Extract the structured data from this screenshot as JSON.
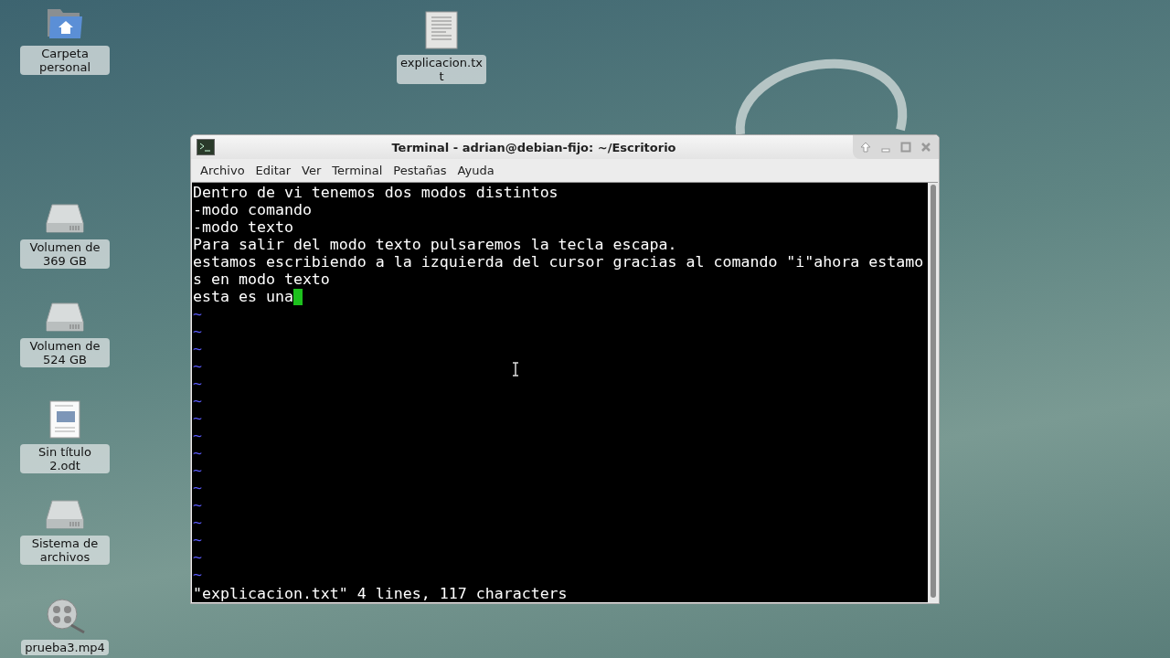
{
  "desktop": {
    "column_icons": [
      {
        "kind": "home-folder",
        "label": "Carpeta personal"
      },
      {
        "kind": "drive",
        "label": "Volumen de 369 GB"
      },
      {
        "kind": "drive",
        "label": "Volumen de 524 GB"
      },
      {
        "kind": "document",
        "label": "Sin título 2.odt"
      },
      {
        "kind": "drive",
        "label": "Sistema de archivos"
      },
      {
        "kind": "video",
        "label": "prueba3.mp4"
      }
    ],
    "top_icons": [
      {
        "kind": "text-file",
        "label": "explicacion.txt"
      }
    ]
  },
  "window": {
    "title": "Terminal - adrian@debian-fijo: ~/Escritorio",
    "menu": [
      "Archivo",
      "Editar",
      "Ver",
      "Terminal",
      "Pestañas",
      "Ayuda"
    ],
    "buffer_lines": [
      {
        "text": "Dentro de vi tenemos dos modos distintos",
        "cursor": false
      },
      {
        "text": "-modo comando",
        "cursor": false
      },
      {
        "text": "-modo texto",
        "cursor": false
      },
      {
        "text": "Para salir del modo texto pulsaremos la tecla escapa.",
        "cursor": false
      },
      {
        "text": "estamos escribiendo a la izquierda del cursor gracias al comando \"i\"ahora estamo",
        "cursor": false
      },
      {
        "text": "s en modo texto",
        "cursor": false
      },
      {
        "text": "esta es una",
        "cursor": true
      }
    ],
    "empty_lines": [
      "~",
      "~",
      "~",
      "~",
      "~",
      "~",
      "~",
      "~",
      "~",
      "~",
      "~",
      "~",
      "~",
      "~",
      "~",
      "~"
    ],
    "status_line": "\"explicacion.txt\" 4 lines, 117 characters"
  }
}
